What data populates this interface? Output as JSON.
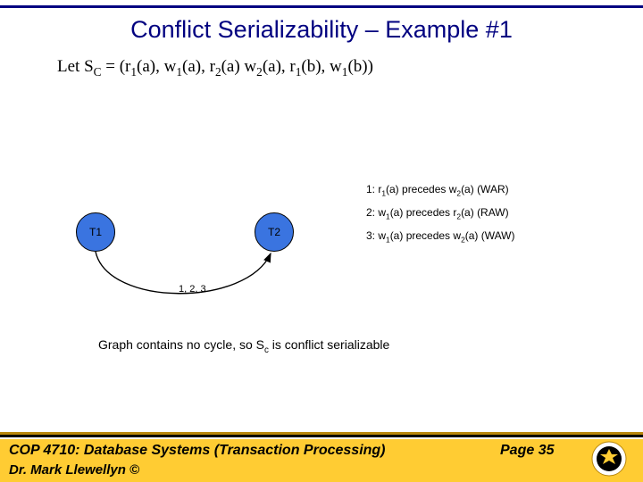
{
  "title": "Conflict Serializability – Example #1",
  "schedule_prefix": "Let S",
  "schedule_sub": "C",
  "schedule_rest_html": " = (r<sub>1</sub>(a), w<sub>1</sub>(a), r<sub>2</sub>(a) w<sub>2</sub>(a), r<sub>1</sub>(b), w<sub>1</sub>(b))",
  "nodes": {
    "t1": "T1",
    "t2": "T2"
  },
  "edge_label": "1, 2, 3",
  "conflicts": [
    "1:  r<sub>1</sub>(a) precedes w<sub>2</sub>(a)  (WAR)",
    "2:  w<sub>1</sub>(a) precedes r<sub>2</sub>(a)  (RAW)",
    "3:  w<sub>1</sub>(a) precedes w<sub>2</sub>(a)  (WAW)"
  ],
  "conclusion_html": "Graph contains no  cycle, so S<sub>c</sub> is conflict serializable",
  "footer": {
    "left": "COP 4710: Database Systems  (Transaction Processing)",
    "page": "Page 35",
    "author": "Dr. Mark Llewellyn ©"
  }
}
